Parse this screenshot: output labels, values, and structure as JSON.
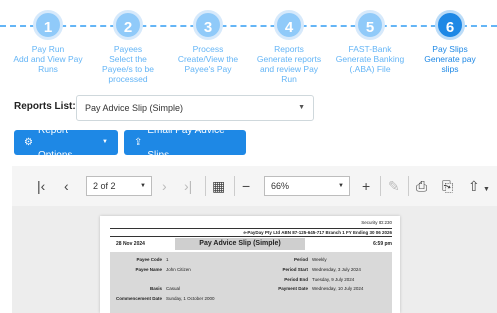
{
  "stepper": {
    "steps": [
      {
        "num": "1",
        "title": "Pay Run",
        "desc1": "Add and View Pay",
        "desc2": "Runs",
        "desc3": ""
      },
      {
        "num": "2",
        "title": "Payees",
        "desc1": "Select the",
        "desc2": "Payee/s to be",
        "desc3": "processed"
      },
      {
        "num": "3",
        "title": "Process",
        "desc1": "Create/View the",
        "desc2": "Payee's Pay",
        "desc3": ""
      },
      {
        "num": "4",
        "title": "Reports",
        "desc1": "Generate reports",
        "desc2": "and review Pay",
        "desc3": "Run"
      },
      {
        "num": "5",
        "title": "FAST-Bank",
        "desc1": "Generate Banking",
        "desc2": "(.ABA) File",
        "desc3": ""
      },
      {
        "num": "6",
        "title": "Pay Slips",
        "desc1": "Generate pay",
        "desc2": "slips",
        "desc3": ""
      }
    ],
    "active_step": 6
  },
  "reports": {
    "label": "Reports List:",
    "selected": "Pay Advice Slip (Simple)"
  },
  "buttons": {
    "report_options": "Report Options",
    "email_slips": "Email Pay Advice Slips"
  },
  "viewer": {
    "page": "2 of 2",
    "zoom": "66%"
  },
  "document": {
    "security_id": "Security ID:230",
    "company": "e-PayDay Pty Ltd ABN 87-125-645-717 Branch 1 FY Ending 30 06 2026",
    "date": "28 Nov 2024",
    "time": "6:59 pm",
    "title": "Pay Advice Slip (Simple)",
    "fields": {
      "payee_code_label": "Payee Code",
      "payee_code": "1",
      "payee_name_label": "Payee Name",
      "payee_name": "John Citizen",
      "basis_label": "Basis",
      "basis": "Casual",
      "commencement_label": "Commencement Date",
      "commencement": "Sunday, 1 October 2000",
      "period_label": "Period",
      "period": "Weekly",
      "period_start_label": "Period Start",
      "period_start": "Wednesday, 3 July 2024",
      "period_end_label": "Period End",
      "period_end": "Tuesday, 9 July 2024",
      "payment_date_label": "Payment Date",
      "payment_date": "Wednesday, 10 July 2024"
    }
  },
  "colors": {
    "accent": "#1e88e5",
    "accent_light": "#64b5f6"
  }
}
